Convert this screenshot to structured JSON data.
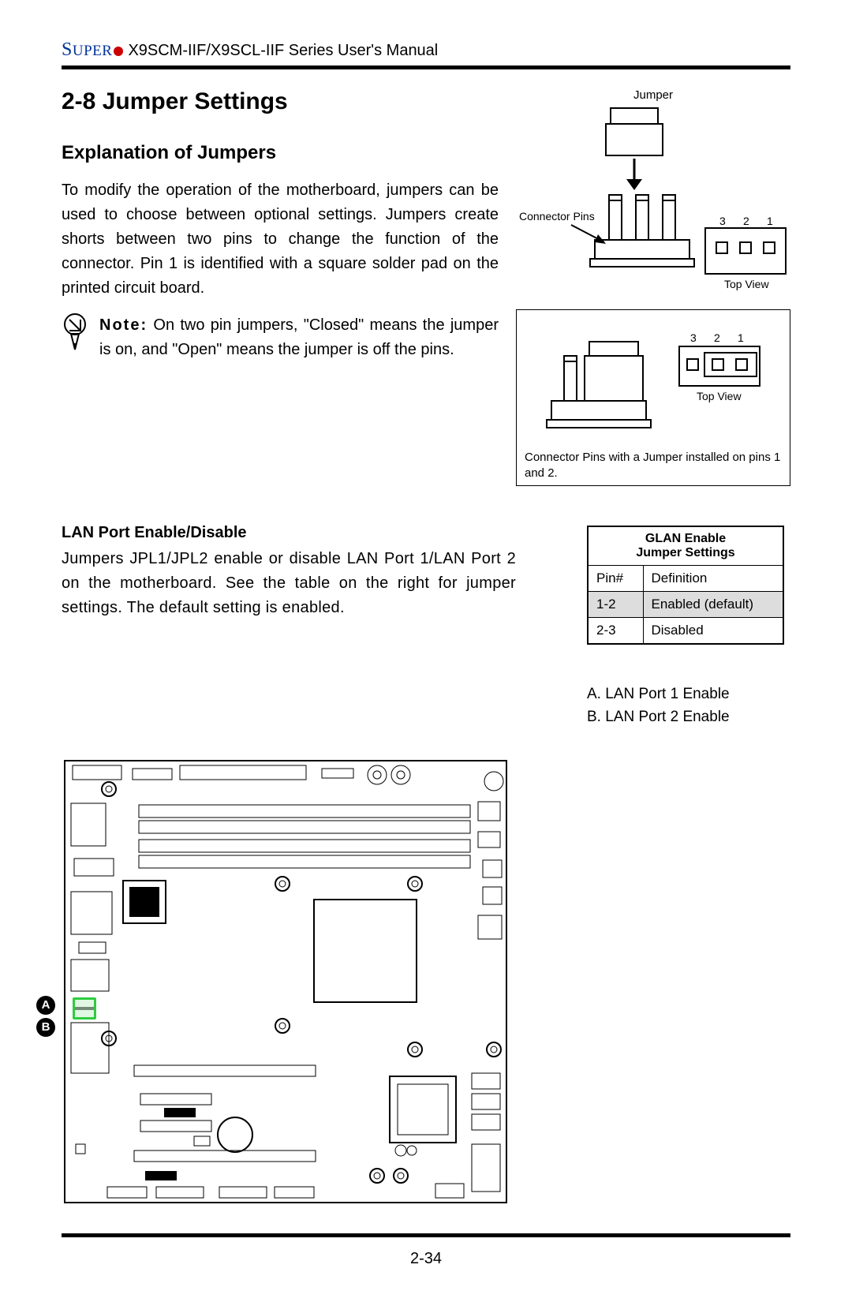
{
  "header": {
    "brand_prefix": "S",
    "brand_rest": "UPER",
    "model_line": "X9SCM-IIF/X9SCL-IIF Series User's Manual"
  },
  "section": {
    "number_title": "2-8   Jumper Settings",
    "subtitle": "Explanation of Jumpers",
    "para1": "To modify the operation of the mother­board, jumpers can be used to choose between optional settings. Jumpers create shorts between two pins to change the function of the connector. Pin 1 is identified with a square solder pad on the printed circuit board.",
    "note_label": "Note:",
    "note_rest": " On two pin jumpers, \"Closed\" means the jumper is on, and \"Open\" means the jumper is off the pins."
  },
  "diagram": {
    "jumper_label": "Jumper",
    "connector_pins": "Connector Pins",
    "pin3": "3",
    "pin2": "2",
    "pin1": "1",
    "top_view": "Top View",
    "installed_caption": "Connector Pins with a Jumper installed on pins 1 and 2."
  },
  "lan": {
    "title": "LAN Port Enable/Disable",
    "para": "Jumpers JPL1/JPL2 enable or disable LAN Port 1/LAN Port 2 on the moth­erboard. See the table on the right for jumper settings. The default setting is enabled."
  },
  "glan_table": {
    "header1": "GLAN Enable",
    "header2": "Jumper Settings",
    "col1": "Pin#",
    "col2": "Definition",
    "r1c1": "1-2",
    "r1c2": "Enabled (default)",
    "r2c1": "2-3",
    "r2c2": "Disabled"
  },
  "legend": {
    "a": "A. LAN Port 1 Enable",
    "b": "B. LAN Port 2 Enable"
  },
  "markers": {
    "a": "A",
    "b": "B"
  },
  "page": "2-34"
}
